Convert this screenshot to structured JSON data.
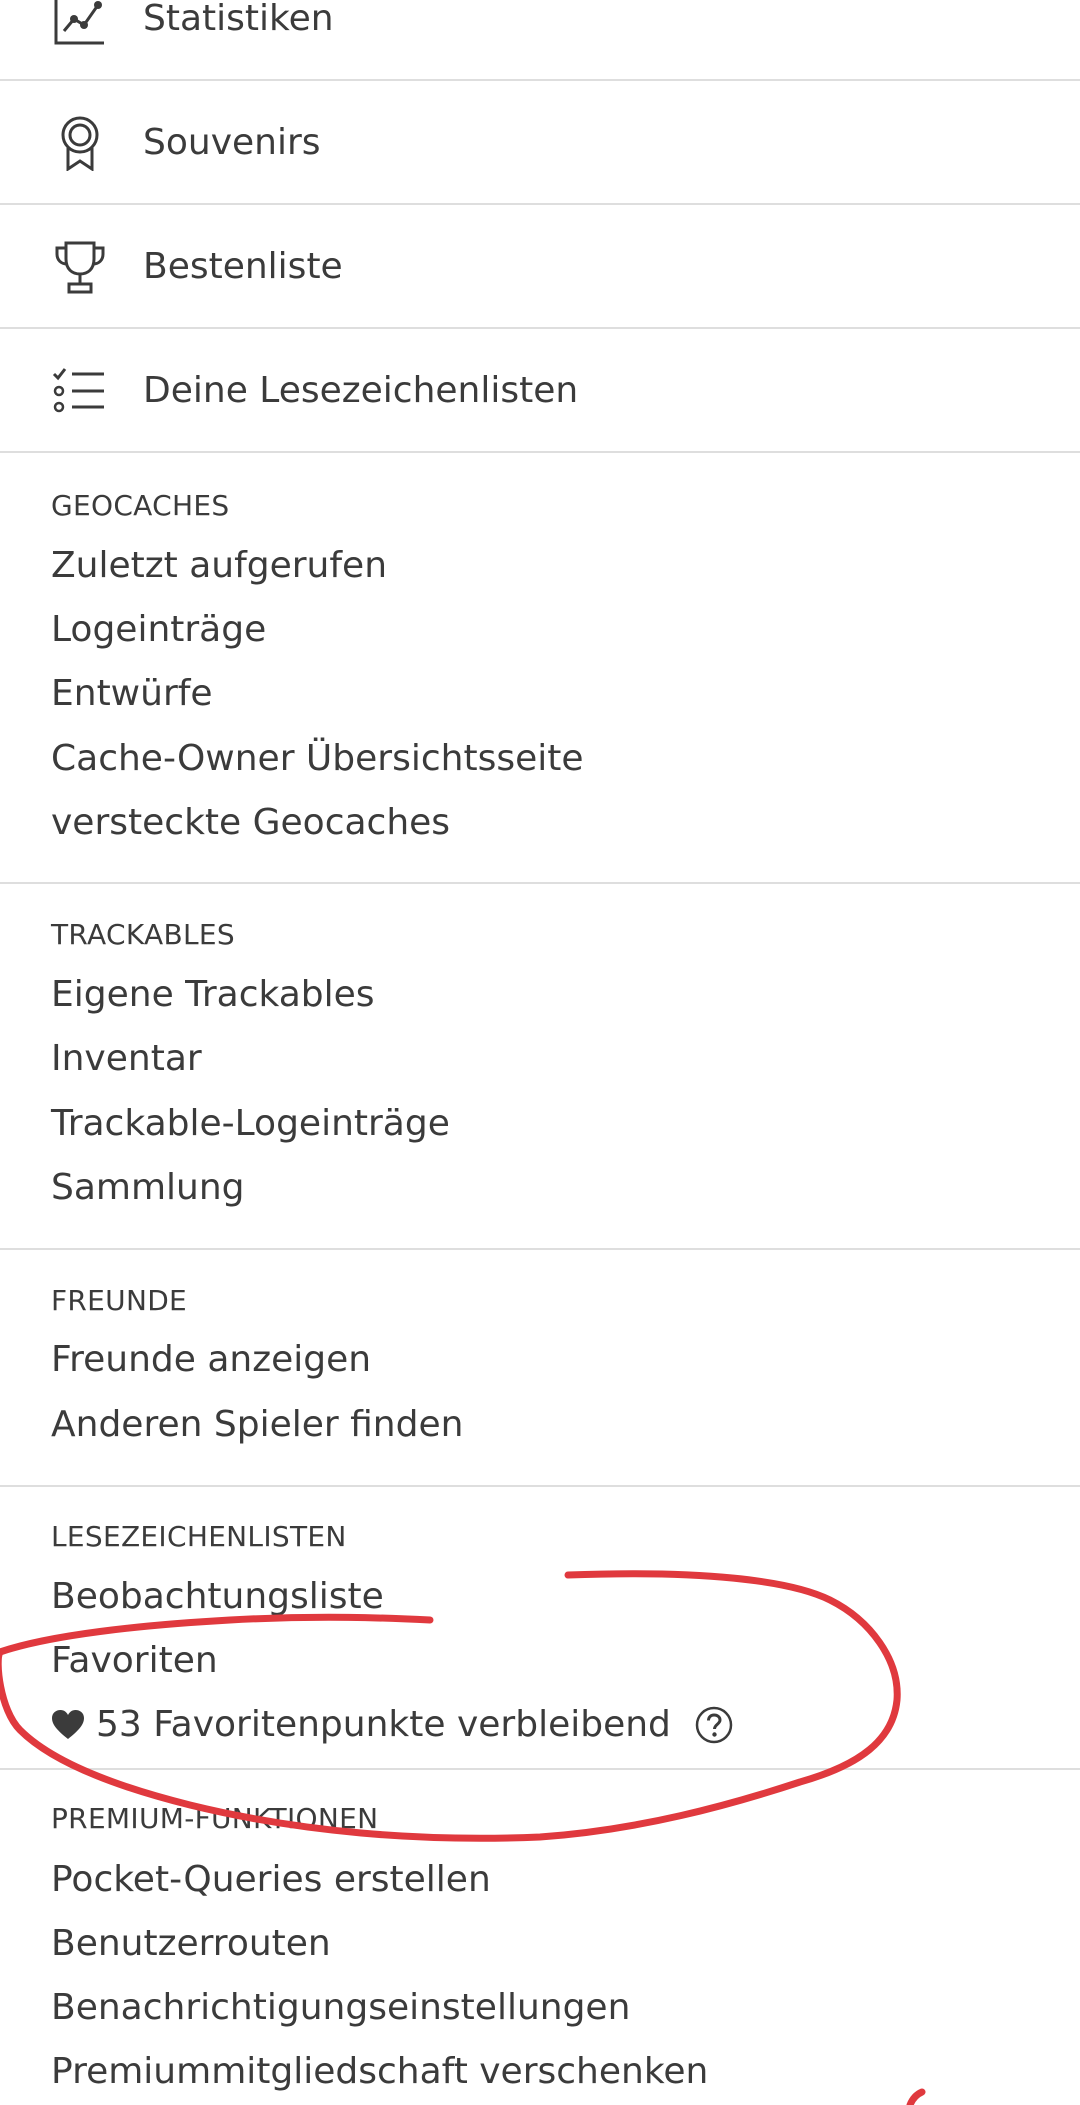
{
  "nav": [
    {
      "label": "Statistiken",
      "icon": "chart-icon"
    },
    {
      "label": "Souvenirs",
      "icon": "badge-icon"
    },
    {
      "label": "Bestenliste",
      "icon": "trophy-icon"
    },
    {
      "label": "Deine Lesezeichenlisten",
      "icon": "checklist-icon"
    }
  ],
  "sections": {
    "geocaches": {
      "heading": "GEOCACHES",
      "links": [
        "Zuletzt aufgerufen",
        "Logeinträge",
        "Entwürfe",
        "Cache-Owner Übersichtsseite",
        "versteckte Geocaches"
      ]
    },
    "trackables": {
      "heading": "TRACKABLES",
      "links": [
        "Eigene Trackables",
        "Inventar",
        "Trackable-Logeinträge",
        "Sammlung"
      ]
    },
    "freunde": {
      "heading": "FREUNDE",
      "links": [
        "Freunde anzeigen",
        "Anderen Spieler finden"
      ]
    },
    "lesezeichen": {
      "heading": "LESEZEICHENLISTEN",
      "links": [
        "Beobachtungsliste",
        "Favoriten"
      ],
      "favorite_points": "53 Favoritenpunkte verbleibend",
      "heart_icon": "heart-icon",
      "help_icon": "question-circle-icon"
    },
    "premium": {
      "heading": "PREMIUM-FUNKTIONEN",
      "links": [
        "Pocket-Queries erstellen",
        "Benutzerrouten",
        "Benachrichtigungseinstellungen",
        "Premiummitgliedschaft verschenken"
      ]
    }
  },
  "colors": {
    "text": "#3b3b3b",
    "divider": "#dedede",
    "annotation": "#e0393e"
  }
}
